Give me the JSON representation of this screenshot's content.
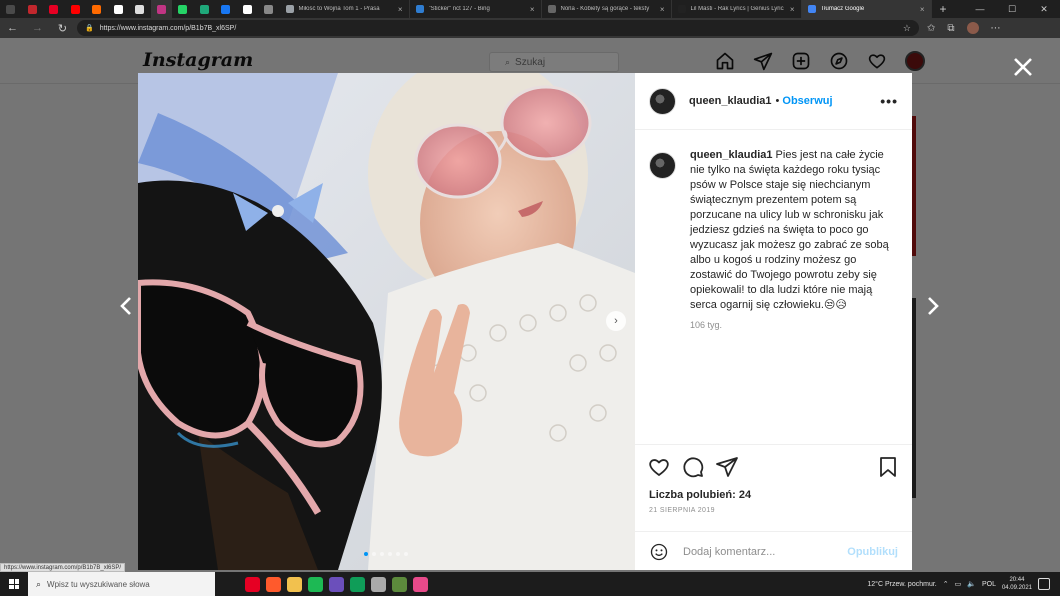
{
  "browser": {
    "tabs": [
      {
        "title": "Miłość to Wojna Tom 1 - Prasa",
        "active": false,
        "color": "#9aa0a6"
      },
      {
        "title": "\"Sticker\" nct 127 - Bing",
        "active": false,
        "color": "#2f7dd1"
      },
      {
        "title": "Norla - Kobiety są gorące - teksty",
        "active": false,
        "color": "#666666"
      },
      {
        "title": "Lil Masti - Rak Lyrics | Genius Lyrics",
        "active": false,
        "color": "#222222"
      },
      {
        "title": "Tłumacz Google",
        "active": true,
        "color": "#4285f4"
      }
    ],
    "pinned_colors": [
      "#4a4a4a",
      "#c1272d",
      "#e60023",
      "#ff0000",
      "#ff6a00",
      "#ffffff",
      "#dddddd",
      "#c13584",
      "#25d366",
      "#1fa87a",
      "#1877f2",
      "#ffffff",
      "#888888"
    ],
    "url": "https://www.instagram.com/p/B1b7B_xl6SP/",
    "status_url": "https://www.instagram.com/p/B1b7B_xl6SP/"
  },
  "instagram": {
    "logo": "Instagram",
    "search_placeholder": "Szukaj"
  },
  "post": {
    "username": "queen_klaudia1",
    "separator": "•",
    "follow_label": "Obserwuj",
    "more_label": "•••",
    "caption": "Pies jest na całe życie nie tylko na święta każdego roku tysiąc psów w Polsce staje się niechcianym świątecznym prezentem potem są porzucane na ulicy lub w schronisku jak jedziesz gdzieś na święta to poco go wyzucasz jak możesz go zabrać ze sobą albo u kogoś u rodziny możesz go zostawić do Twojego powrotu zeby się opiekowali! to dla ludzi które nie mają serca ogarnij się człowieku.😒😥",
    "caption_age": "106 tyg.",
    "likes": "Liczba polubień: 24",
    "date": "21 SIERPNIA 2019",
    "comment_placeholder": "Dodaj komentarz...",
    "publish_label": "Opublikuj",
    "carousel": {
      "count": 6,
      "active": 0
    }
  },
  "taskbar": {
    "search_placeholder": "Wpisz tu wyszukiwane słowa",
    "app_colors": [
      "#e60023",
      "#ff5a2c",
      "#f2c14e",
      "#1db954",
      "#6b4fbb",
      "#0f9d58",
      "#aaaaaa",
      "#5c8a3c",
      "#e84a8a"
    ],
    "weather": "12°C  Przew. pochmur.",
    "language": "POL",
    "time": "20:44",
    "date": "04.09.2021"
  }
}
